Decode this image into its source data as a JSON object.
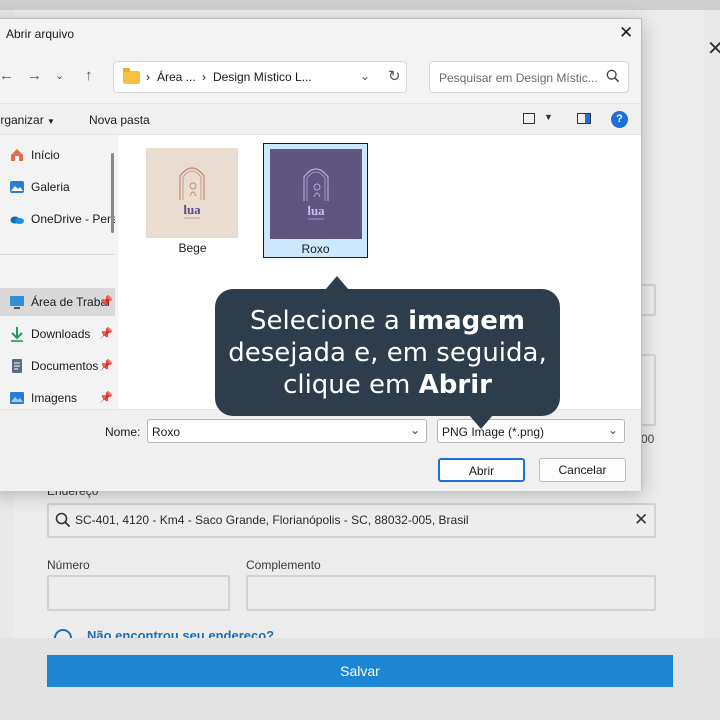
{
  "background_form": {
    "address_label": "Endereço",
    "address_value": "SC-401, 4120 - Km4 - Saco Grande, Florianópolis - SC, 88032-005, Brasil",
    "number_label": "Número",
    "complement_label": "Complemento",
    "not_found_link": "Não encontrou seu endereço?",
    "save_label": "Salvar",
    "partial_value": "00"
  },
  "dialog": {
    "title": "Abrir arquivo",
    "breadcrumbs": [
      "Área ...",
      "Design Místico L..."
    ],
    "search_placeholder": "Pesquisar em Design Místic...",
    "toolbar": {
      "organize": "Organizar",
      "new_folder": "Nova pasta"
    },
    "sidebar": [
      {
        "label": "Início",
        "icon": "home-icon"
      },
      {
        "label": "Galeria",
        "icon": "gallery-icon"
      },
      {
        "label": "OneDrive - Perso",
        "icon": "onedrive-icon"
      },
      {
        "label": "Área de Trabal",
        "icon": "desktop-icon",
        "selected": true
      },
      {
        "label": "Downloads",
        "icon": "download-icon"
      },
      {
        "label": "Documentos",
        "icon": "documents-icon"
      },
      {
        "label": "Imagens",
        "icon": "images-icon"
      }
    ],
    "files": [
      {
        "name": "Bege",
        "logo_text": "lua",
        "bg": "#e9ddd1",
        "fg": "#c08a73"
      },
      {
        "name": "Roxo",
        "logo_text": "lua",
        "bg": "#5f557e",
        "fg": "#b8a8dc",
        "selected": true
      }
    ],
    "name_label": "Nome:",
    "name_value": "Roxo",
    "file_type": "PNG Image (*.png)",
    "open_label": "Abrir",
    "cancel_label": "Cancelar"
  },
  "tooltip": {
    "line1_a": "Selecione a ",
    "line1_b": "imagem",
    "line2": "desejada e, em seguida,",
    "line3_a": "clique em ",
    "line3_b": "Abrir"
  },
  "colors": {
    "accent": "#1e6fd9",
    "save_button": "#1c86d4",
    "tooltip_bg": "#2d3d4c"
  }
}
